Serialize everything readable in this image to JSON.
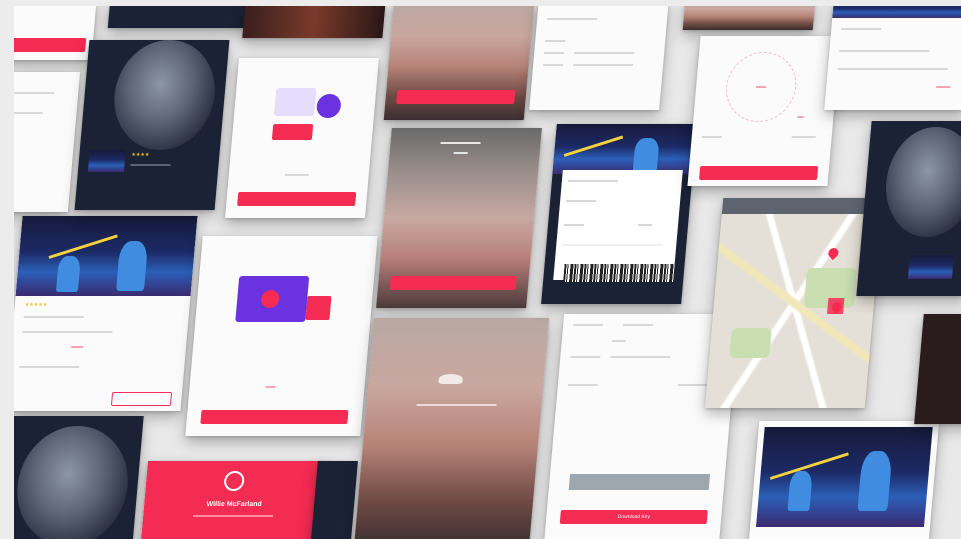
{
  "mockups": {
    "profile_card": {
      "name": "Willie McFarland"
    },
    "map_card": {
      "has_pins": true
    },
    "ticket_card": {
      "button_label": "Download Key"
    },
    "splash_card": {
      "logo_text": ""
    }
  },
  "colors": {
    "accent": "#f42b52",
    "purple": "#6a32e0",
    "dark_bg": "#1b2236",
    "background": "#e9e9e9"
  }
}
